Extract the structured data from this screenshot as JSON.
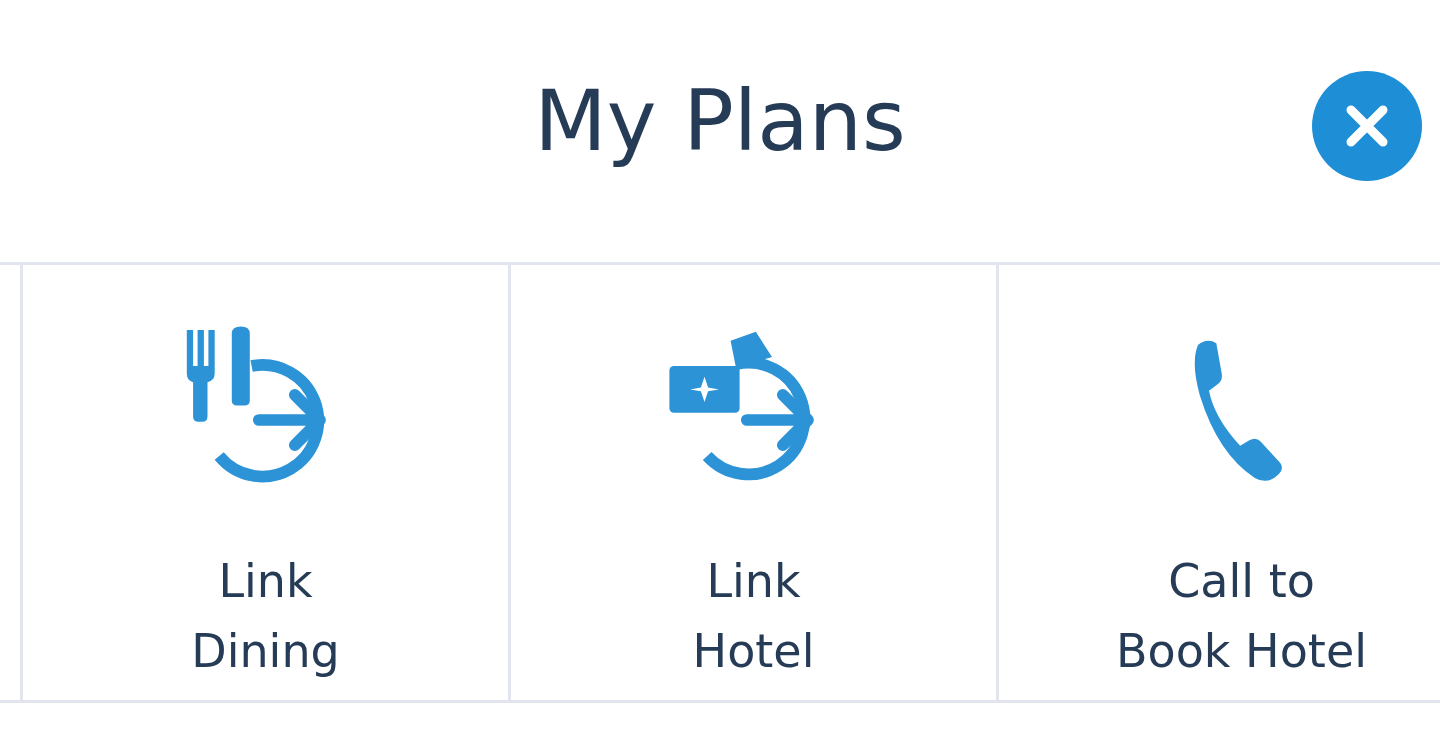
{
  "title": "My Plans",
  "actions": [
    {
      "kind": "dining",
      "label": "Link\nDining"
    },
    {
      "kind": "hotel",
      "label": "Link\nHotel"
    },
    {
      "kind": "phone",
      "label": "Call to\nBook Hotel"
    }
  ]
}
